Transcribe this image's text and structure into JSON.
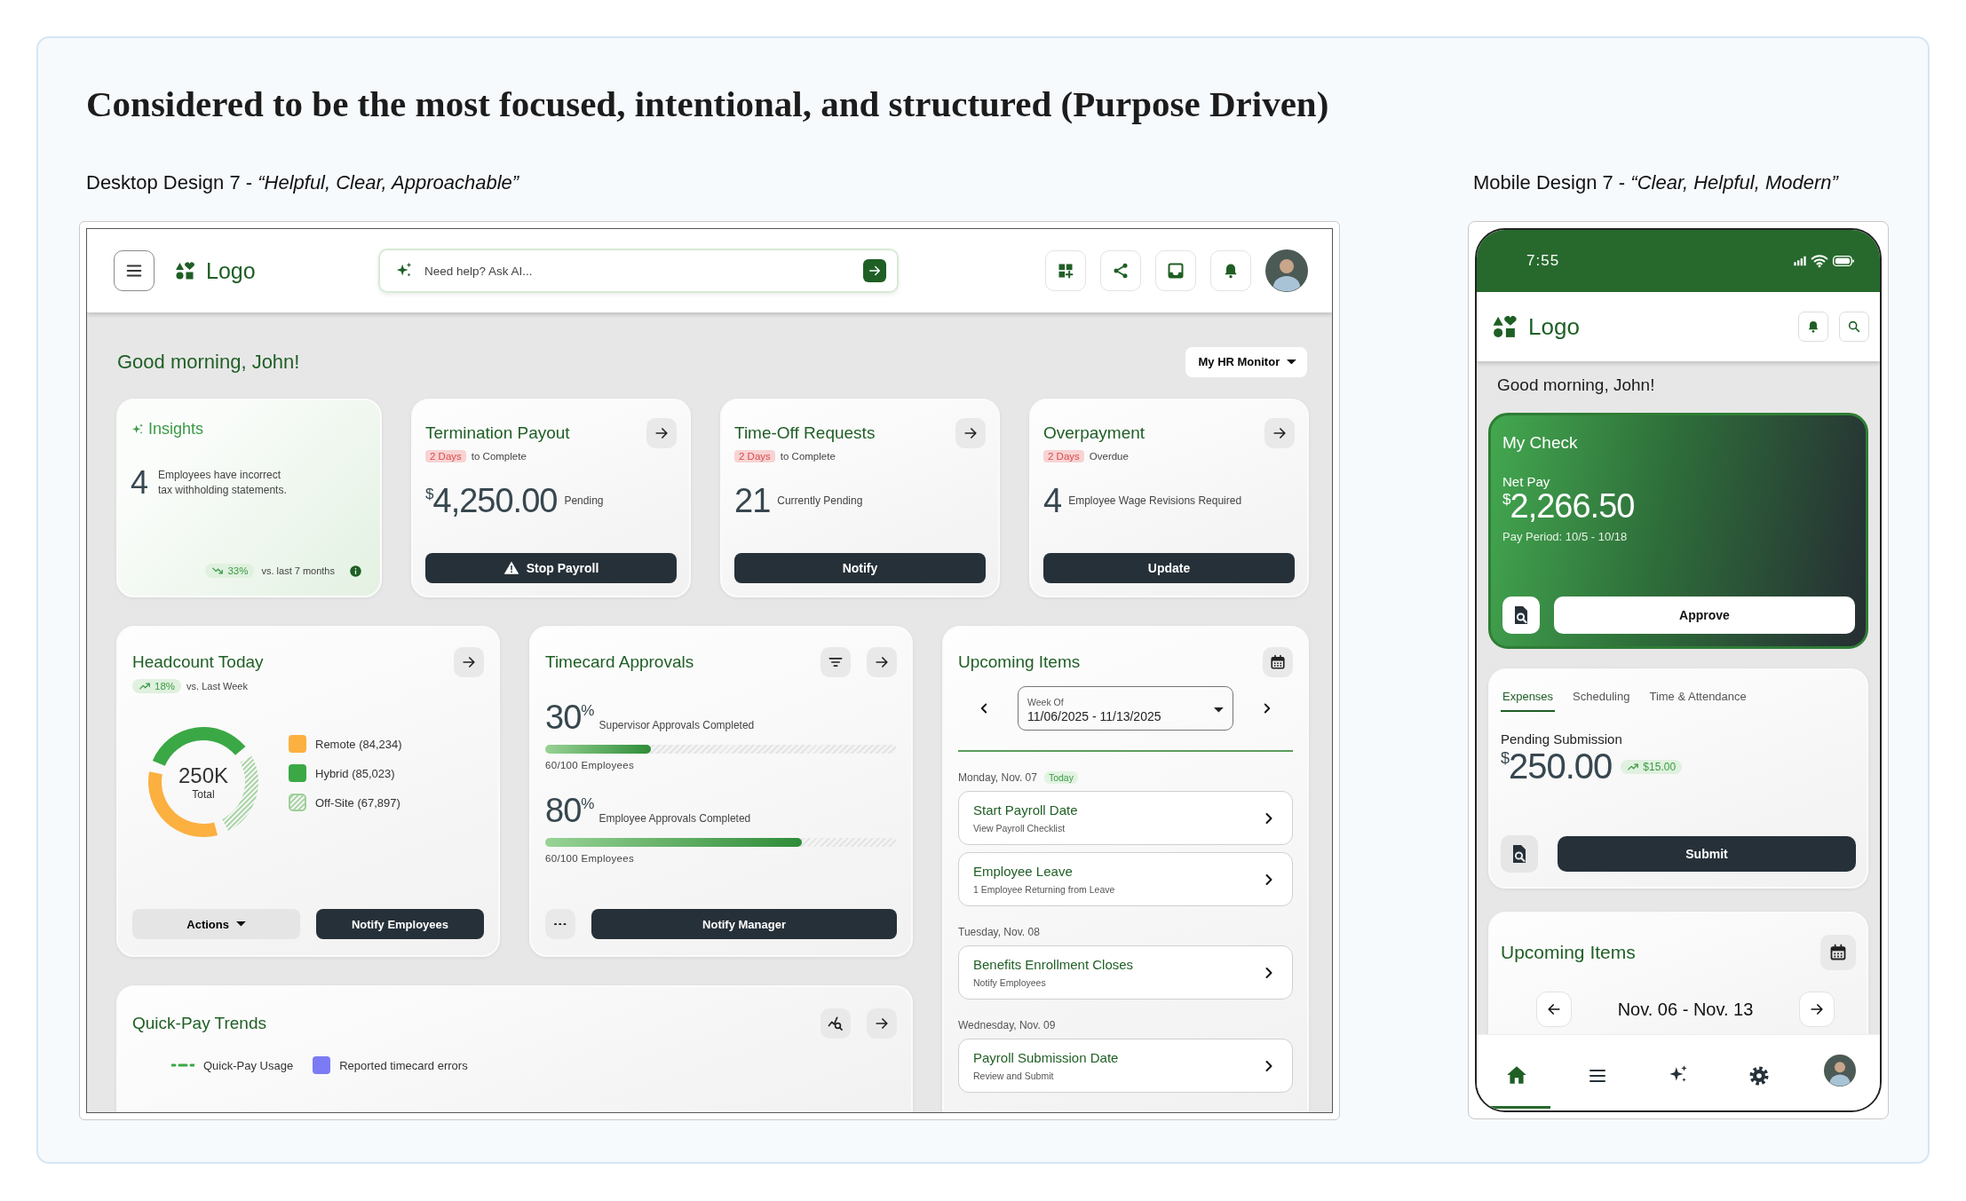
{
  "heading": "Considered to be the most focused, intentional, and structured (Purpose Driven)",
  "desktop_caption": "Desktop Design 7 - *“Helpful, Clear, Approachable”*",
  "mobile_caption": "Mobile Design 7 - *“Clear, Helpful, Modern”*",
  "desktop": {
    "logo": "Logo",
    "search": {
      "placeholder": "Need help? Ask AI..."
    },
    "greeting": "Good morning, John!",
    "monitor_menu": "My HR Monitor",
    "insights": {
      "title": "Insights",
      "count": "4",
      "text": "Employees have incorrect tax withholding statements.",
      "trend": "33%",
      "trend_note": "vs. last 7 months"
    },
    "alert_cards": [
      {
        "title": "Termination Payout",
        "badge": "2 Days",
        "badge_note": "to Complete",
        "currency": "$",
        "value": "4,250.00",
        "value_note": "Pending",
        "button": "Stop Payroll",
        "warning": true
      },
      {
        "title": "Time-Off Requests",
        "badge": "2 Days",
        "badge_note": "to Complete",
        "value": "21",
        "value_note": "Currently Pending",
        "button": "Notify",
        "warning": false
      },
      {
        "title": "Overpayment",
        "badge": "2 Days",
        "badge_note": "Overdue",
        "value": "4",
        "value_note": "Employee Wage Revisions Required",
        "button": "Update",
        "warning": false
      }
    ],
    "headcount": {
      "title": "Headcount Today",
      "trend": "18%",
      "trend_note": "vs. Last Week",
      "total": "250K",
      "total_label": "Total",
      "legend": [
        {
          "kind": "solid",
          "color": "#fbb040"
        },
        {
          "kind": "solid",
          "color": "#3aa845"
        },
        {
          "kind": "hatched",
          "color": "#9fd09c"
        }
      ],
      "chart_data": {
        "type": "donut",
        "categories": [
          "Remote (84,234)",
          "Hybrid (85,023)",
          "Off-Site (67,897)"
        ],
        "values": [
          84234,
          85023,
          67897
        ]
      },
      "actions_button": "Actions",
      "notify_button": "Notify Employees"
    },
    "timecard": {
      "title": "Timecard Approvals",
      "metrics": [
        {
          "value": "30$^{%}$",
          "label": "Supervisor Approvals Completed",
          "level": 0.3,
          "count": "60/100 Employees"
        },
        {
          "value": "80$^{%}$",
          "label": "Employee Approvals Completed",
          "level": 0.73,
          "count": "60/100 Employees"
        }
      ],
      "button": "Notify Manager"
    },
    "upcoming": {
      "title": "Upcoming Items",
      "week_label": "Week Of",
      "week_value": "11/06/2025 - 11/13/2025",
      "days": [
        {
          "date": "Monday, Nov. 07",
          "badge": "Today",
          "items": [
            {
              "title": "Start Payroll Date",
              "subtitle": "View Payroll Checklist"
            },
            {
              "title": "Employee Leave",
              "subtitle": "1 Employee Returning from Leave"
            }
          ]
        },
        {
          "date": "Tuesday, Nov. 08",
          "items": [
            {
              "title": "Benefits Enrollment Closes",
              "subtitle": "Notify Employees"
            }
          ]
        },
        {
          "date": "Wednesday, Nov. 09",
          "items": [
            {
              "title": "Payroll Submission Date",
              "subtitle": "Review and Submit"
            }
          ]
        }
      ]
    },
    "quick_pay": {
      "title": "Quick-Pay Trends",
      "legend": [
        {
          "kind": "line",
          "label": "Quick-Pay Usage",
          "color": "#3aa845"
        },
        {
          "kind": "swatch",
          "label": "Reported timecard errors",
          "color": "#7b7bf5"
        }
      ]
    }
  },
  "mobile": {
    "time": "7:55",
    "logo": "Logo",
    "greeting": "Good morning, John!",
    "check": {
      "title": "My Check",
      "label": "Net Pay",
      "currency": "$",
      "amount": "2,266.50",
      "period": "Pay Period: 10/5 - 10/18",
      "button": "Approve"
    },
    "tabs": [
      {
        "label": "Expenses",
        "selected": true
      },
      {
        "label": "Scheduling",
        "selected": false
      },
      {
        "label": "Time & Attendance",
        "selected": false
      }
    ],
    "pending": {
      "label": "Pending Submission",
      "currency": "$",
      "amount": "250.00",
      "delta": "$15.00",
      "button": "Submit"
    },
    "upcoming": {
      "title": "Upcoming Items",
      "range": "Nov. 06 - Nov. 13"
    },
    "nav": [
      {
        "kind": "home",
        "selected": true
      },
      {
        "kind": "menu",
        "selected": false
      },
      {
        "kind": "ai",
        "selected": false
      },
      {
        "kind": "settings",
        "selected": false
      },
      {
        "kind": "profile",
        "selected": false
      }
    ]
  }
}
